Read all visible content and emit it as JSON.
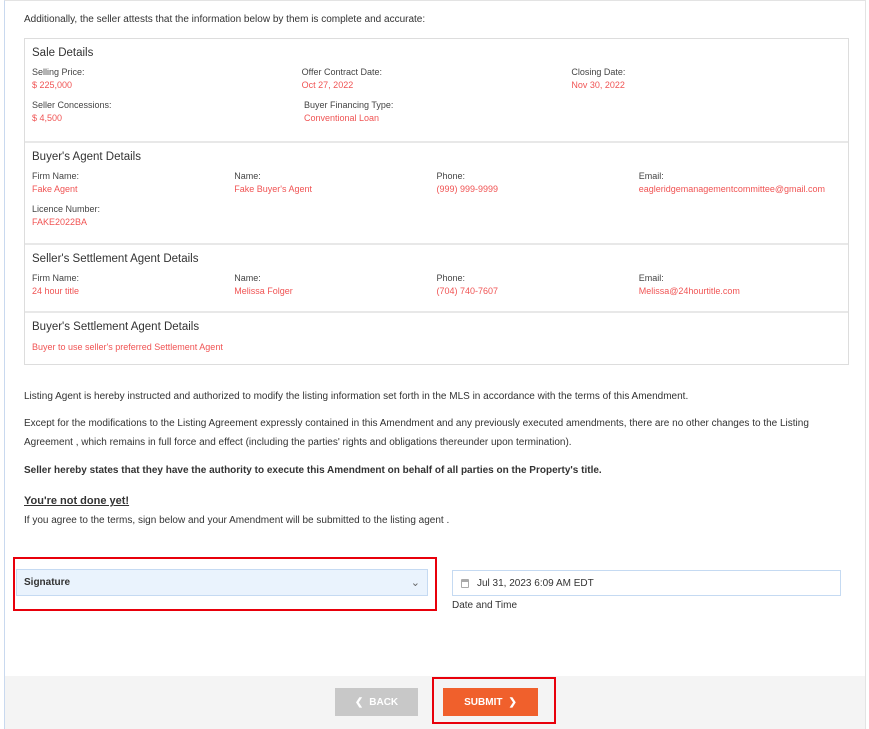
{
  "intro": "Additionally, the seller attests that the information below by them is complete and accurate:",
  "sale": {
    "title": "Sale Details",
    "fields": [
      {
        "label": "Selling Price:",
        "value": "$ 225,000"
      },
      {
        "label": "Offer Contract Date:",
        "value": "Oct 27, 2022"
      },
      {
        "label": "Closing Date:",
        "value": "Nov 30, 2022"
      },
      {
        "label": "Seller Concessions:",
        "value": "$ 4,500"
      },
      {
        "label": "Buyer Financing Type:",
        "value": "Conventional Loan"
      }
    ]
  },
  "buyer_agent": {
    "title": "Buyer's Agent Details",
    "fields": [
      {
        "label": "Firm Name:",
        "value": "Fake Agent"
      },
      {
        "label": "Name:",
        "value": "Fake Buyer's Agent"
      },
      {
        "label": "Phone:",
        "value": "(999) 999-9999"
      },
      {
        "label": "Email:",
        "value": "eagleridgemanagementcommittee@gmail.com"
      },
      {
        "label": "Licence Number:",
        "value": "FAKE2022BA"
      }
    ]
  },
  "seller_settlement": {
    "title": "Seller's Settlement Agent Details",
    "fields": [
      {
        "label": "Firm Name:",
        "value": "24 hour title"
      },
      {
        "label": "Name:",
        "value": "Melissa Folger"
      },
      {
        "label": "Phone:",
        "value": "(704) 740-7607"
      },
      {
        "label": "Email:",
        "value": "Melissa@24hourtitle.com"
      }
    ]
  },
  "buyer_settlement": {
    "title": "Buyer's Settlement Agent Details",
    "value": "Buyer to use seller's preferred Settlement Agent"
  },
  "para1": "Listing Agent is hereby instructed and authorized to modify the listing information set forth in the MLS in accordance with the terms of this Amendment.",
  "para2": "Except for the modifications to the Listing Agreement expressly contained in this Amendment and any previously executed amendments, there are no other changes to the Listing Agreement , which remains in full force and effect (including the parties' rights and obligations thereunder upon termination).",
  "para3": "Seller hereby states that they have the authority to execute this Amendment on behalf of all parties on the Property's title.",
  "not_done": "You're not done yet!",
  "agree": "If you agree to the terms, sign below and your Amendment will be submitted to the listing agent .",
  "signature": {
    "value": "Signature"
  },
  "datetime": {
    "value": "Jul 31, 2023 6:09 AM EDT",
    "label": "Date and Time"
  },
  "buttons": {
    "back": "BACK",
    "submit": "SUBMIT"
  },
  "colors": {
    "accent": "#f05454",
    "submit": "#f0602c",
    "back": "#c8c8c8"
  }
}
